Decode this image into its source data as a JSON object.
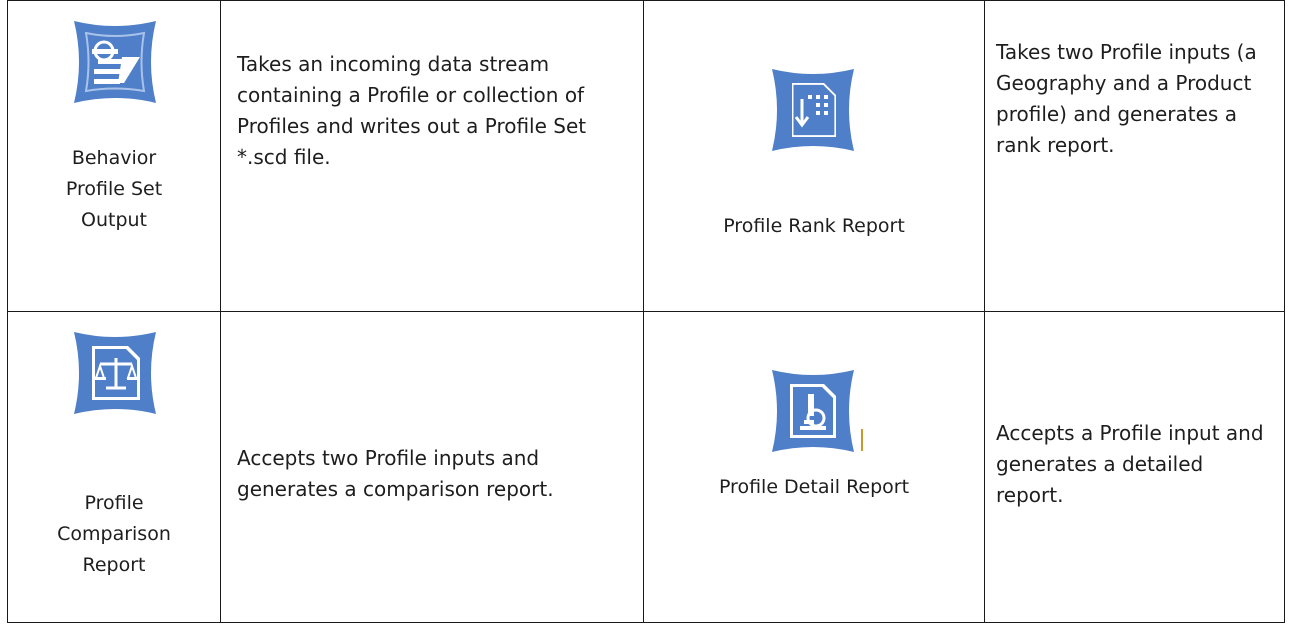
{
  "tools": [
    {
      "icon": "profile-set-output-icon",
      "name_lines": [
        "Behavior",
        "Profile Set",
        "Output"
      ],
      "description": "Takes an incoming data stream containing a Profile or collection of Profiles and writes out a Profile Set *.scd file."
    },
    {
      "icon": "profile-rank-report-icon",
      "name_lines": [
        "Profile Rank Report"
      ],
      "description": "Takes two Profile inputs (a Geography and a Product profile) and generates a rank report."
    },
    {
      "icon": "profile-comparison-report-icon",
      "name_lines": [
        "Profile",
        "Comparison",
        "Report"
      ],
      "description": "Accepts two Profile inputs and generates a comparison report."
    },
    {
      "icon": "profile-detail-report-icon",
      "name_lines": [
        "Profile Detail Report"
      ],
      "description": "Accepts a Profile input and generates a detailed report."
    }
  ],
  "colors": {
    "icon_blue": "#4f7fc8",
    "icon_light": "#a9c2ea",
    "border": "#1a1a1a",
    "cursor": "#c79a2a"
  }
}
